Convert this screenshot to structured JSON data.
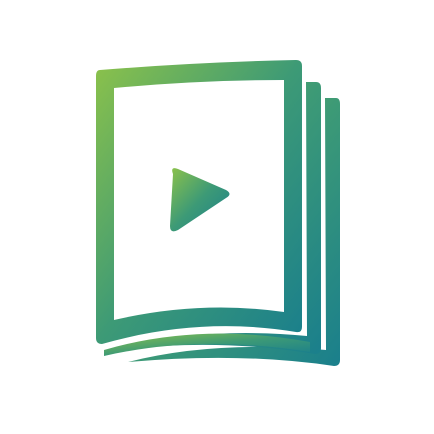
{
  "logo": {
    "icon": "video-pages-icon",
    "colors": {
      "gradient_start": "#8cc24a",
      "gradient_mid": "#3d9a76",
      "gradient_end": "#1a7f8c",
      "inner_fill": "#ffffff"
    }
  }
}
